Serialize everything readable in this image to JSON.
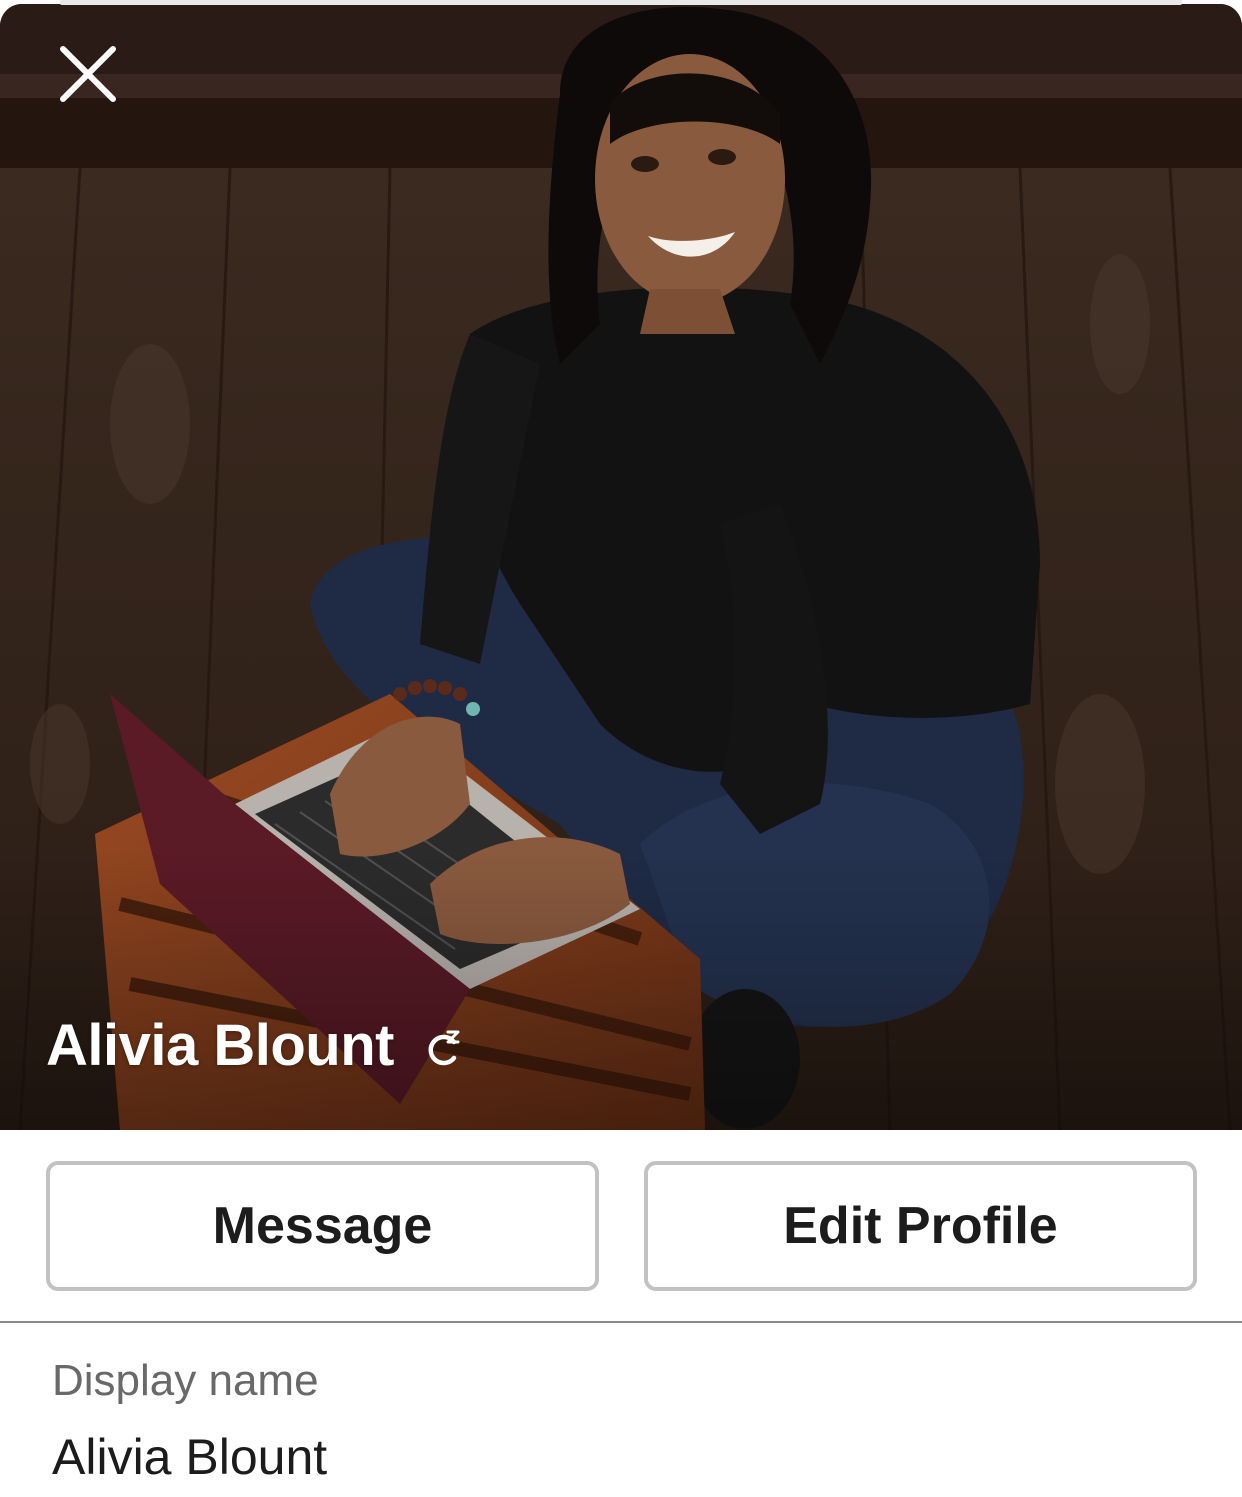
{
  "profile": {
    "name": "Alivia Blount",
    "status_icon": "sleeping-status-icon"
  },
  "header": {
    "close_icon": "close-icon"
  },
  "actions": {
    "message_label": "Message",
    "edit_profile_label": "Edit Profile"
  },
  "fields": [
    {
      "label": "Display name",
      "value": "Alivia Blount"
    }
  ],
  "colors": {
    "button_border": "#c2c2c2",
    "text_primary": "#1d1c1d",
    "text_secondary": "#696969",
    "divider": "#8a8a8a"
  }
}
